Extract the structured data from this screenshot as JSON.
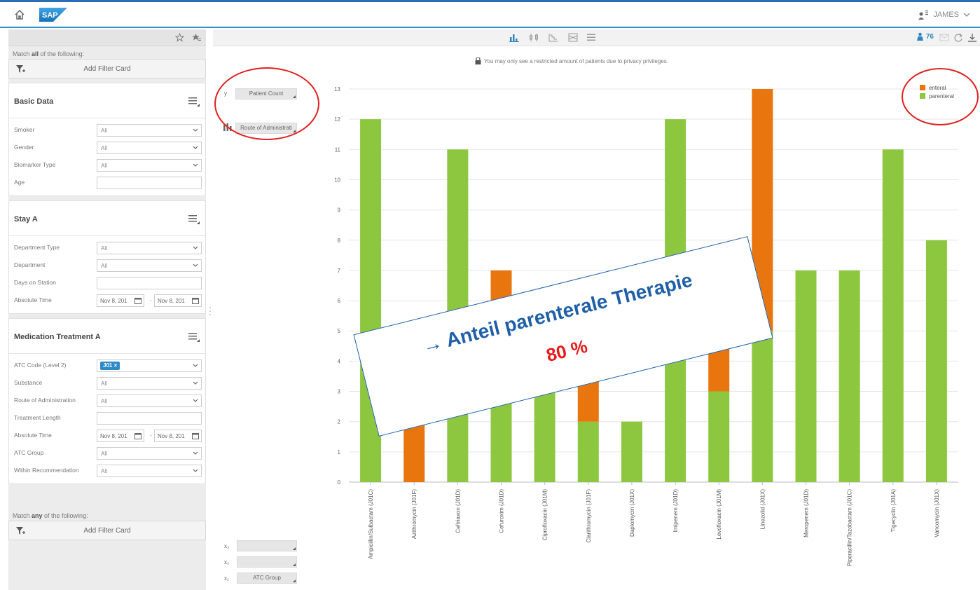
{
  "header": {
    "user_name": "JAMES"
  },
  "sidebar": {
    "match_all_prefix": "Match ",
    "match_all_bold": "all",
    "match_all_suffix": " of the following:",
    "add_filter_card_label": "Add Filter Card",
    "match_any_prefix": "Match ",
    "match_any_bold": "any",
    "match_any_suffix": " of the following:",
    "basic_data": {
      "title": "Basic Data",
      "smoker_label": "Smoker",
      "smoker_value": "All",
      "gender_label": "Gender",
      "gender_value": "All",
      "biomarker_label": "Biomarker Type",
      "biomarker_value": "All",
      "age_label": "Age",
      "age_value": ""
    },
    "stay_a": {
      "title": "Stay A",
      "dept_type_label": "Department Type",
      "dept_type_value": "All",
      "dept_label": "Department",
      "dept_value": "All",
      "days_label": "Days on Station",
      "days_value": "",
      "abs_time_label": "Absolute Time",
      "abs_from": "Nov 8, 201",
      "abs_to": "Nov 8, 201",
      "dash": "-"
    },
    "medication": {
      "title": "Medication Treatment A",
      "atc_label": "ATC Code (Level 2)",
      "atc_token": "J01 ×",
      "substance_label": "Substance",
      "substance_value": "All",
      "route_label": "Route of Administration",
      "route_value": "All",
      "length_label": "Treatment Length",
      "length_value": "",
      "abs_time_label": "Absolute Time",
      "abs_from": "Nov 8, 201",
      "abs_to": "Nov 8, 201",
      "dash": "-",
      "atc_group_label": "ATC Group",
      "atc_group_value": "All",
      "within_label": "Within Recommendation",
      "within_value": "All"
    }
  },
  "toolbar": {
    "patient_count": "76"
  },
  "privacy_notice": "You may only see a restricted amount of patients due to privacy privileges.",
  "dimensions": {
    "y_label": "y",
    "y_value": "Patient Count",
    "stack_value": "Route of Administrati",
    "x3_label": "x₃",
    "x2_label": "x₂",
    "x1_label": "x₁",
    "x3_value": "",
    "x2_value": "",
    "x1_value": "ATC Group"
  },
  "overlay": {
    "title": "→ Anteil parenterale Therapie",
    "percent": "80 %"
  },
  "colors": {
    "enteral": "#e8750e",
    "parenteral": "#8dc63f",
    "accent": "#2e86c1"
  },
  "chart_data": {
    "type": "bar",
    "stacked": true,
    "categories": [
      "Ampicillin/Sulbactam (J01C)",
      "Azithromycin (J01F)",
      "Ceftriaxon (J01D)",
      "Cefuroxim (J01D)",
      "Ciprofloxacin (J01M)",
      "Clarithromycin (J01F)",
      "Daptomycin (J01X)",
      "Imipenem (J01D)",
      "Levofloxacin (J01M)",
      "Linezolid (J01X)",
      "Meropenem (J01D)",
      "Piperacillin/Tazobactam (J01C)",
      "Tigecyclin (J01A)",
      "Vancomycin (J01X)"
    ],
    "series": [
      {
        "name": "parenteral",
        "values": [
          12,
          0,
          11,
          3,
          4,
          2,
          2,
          12,
          3,
          5,
          7,
          7,
          11,
          8
        ]
      },
      {
        "name": "enteral",
        "values": [
          0,
          2,
          0,
          4,
          0,
          2,
          0,
          0,
          2,
          8,
          0,
          0,
          0,
          0
        ]
      }
    ],
    "ylim": [
      0,
      13
    ],
    "yticks": [
      0,
      1,
      2,
      3,
      4,
      5,
      6,
      7,
      8,
      9,
      10,
      11,
      12,
      13
    ],
    "grid": true,
    "legend_position": "top-right"
  }
}
